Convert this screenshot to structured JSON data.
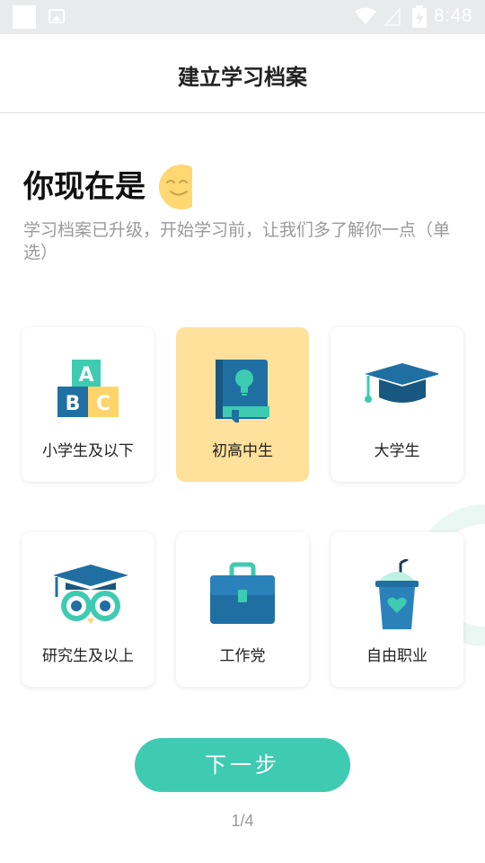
{
  "status_bar": {
    "time": "8:48",
    "icons": [
      "notification-square-icon",
      "image-icon",
      "wifi-icon",
      "signal-icon",
      "battery-charging-icon"
    ]
  },
  "header": {
    "title": "建立学习档案"
  },
  "intro": {
    "heading": "你现在是",
    "heading_icon": "smiley-icon",
    "subtitle": "学习档案已升级，开始学习前，让我们多了解你一点（单选）"
  },
  "options": [
    {
      "label": "小学生及以下",
      "icon": "abc-blocks-icon",
      "selected": false
    },
    {
      "label": "初高中生",
      "icon": "book-lightbulb-icon",
      "selected": true
    },
    {
      "label": "大学生",
      "icon": "graduation-cap-icon",
      "selected": false
    },
    {
      "label": "研究生及以上",
      "icon": "owl-graduate-icon",
      "selected": false
    },
    {
      "label": "工作党",
      "icon": "briefcase-icon",
      "selected": false
    },
    {
      "label": "自由职业",
      "icon": "drink-cup-icon",
      "selected": false
    }
  ],
  "footer": {
    "next_label": "下一步",
    "page_indicator": "1/4"
  },
  "colors": {
    "accent": "#3ecbb1",
    "selected_card": "#ffe19b",
    "navy": "#1f6fa3",
    "yellow": "#ffd56b"
  }
}
